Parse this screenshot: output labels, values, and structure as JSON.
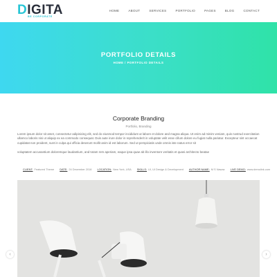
{
  "header": {
    "logo_text": "IGITA",
    "logo_letter": "D",
    "logo_tagline": "BE CORPORATE",
    "nav": [
      "HOME",
      "ABOUT",
      "SERVICES",
      "PORTFOLIO",
      "PAGES",
      "BLOG",
      "CONTACT"
    ]
  },
  "hero": {
    "title": "PORTFOLIO DETAILS",
    "breadcrumb": "HOME / PORTFOLIO DETAILS"
  },
  "project": {
    "title": "Corporate Branding",
    "subtitle": "Portfolio, Branding",
    "description_1": "Lorem ipsum dolor sit amet, consectetur adipisicing elit, sed do eiusmod tempor incididunt ut labore et dolore and magna aliqua. Ut enim ad minim veniam, quis nostrud exercitation ullamco laboris nisi ut aliquip ex ea commodo consequat. Duis aute irure dolor in reprehenderit in voluptate velit esse cillum dolore eu fugiat nulla pariatur. Excepteur sint occaecat cupidatat non proident, sunt in culpa qui officia deserunt mollit anim id est laborum. Sed ut perspiciatis unde omnis iste natus error sit",
    "description_2": "voluptatem accusantium doloremque laudantium, and totam rem aperiam, eaque ipsa quae ab illo inventore veritatis et quasi architecto beatae",
    "meta": [
      {
        "label": "CLIENT:",
        "value": "Featured Theme"
      },
      {
        "label": "DATE:",
        "value": "24 December 2016"
      },
      {
        "label": "LOCATION:",
        "value": "New York, USA"
      },
      {
        "label": "SKILLS:",
        "value": "UI, UI Design & Development"
      },
      {
        "label": "AUTHOR NAME:",
        "value": "M S Nawaz"
      },
      {
        "label": "LIVE DEMO:",
        "value": "www.demolink.com"
      }
    ]
  },
  "gallery": {
    "prev_icon": "chevron-left-icon",
    "next_icon": "chevron-right-icon",
    "prev_glyph": "‹",
    "next_glyph": "›"
  },
  "colors": {
    "accent": "#29c6d6",
    "hero_start": "#3ed8f0",
    "hero_end": "#2fe2a8"
  }
}
